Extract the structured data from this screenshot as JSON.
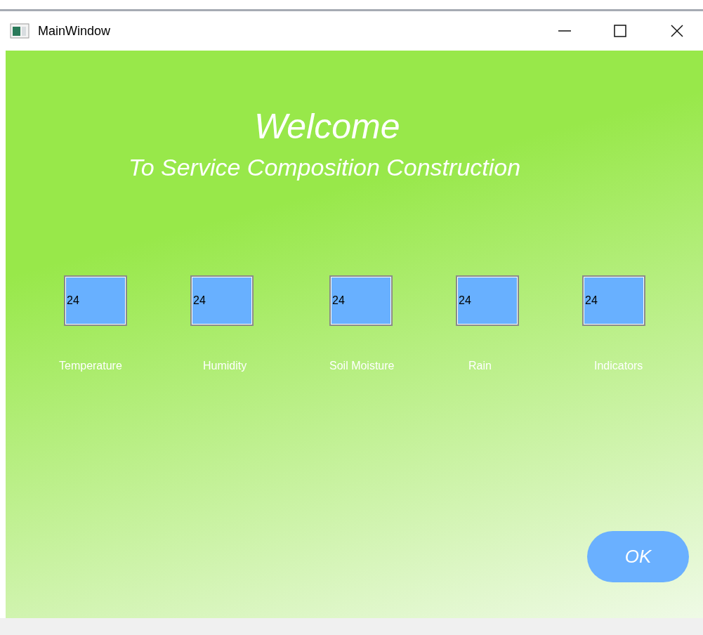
{
  "window": {
    "title": "MainWindow"
  },
  "heading": "Welcome",
  "subheading": "To Service Composition Construction",
  "sensors": [
    {
      "label": "Temperature",
      "value": "24"
    },
    {
      "label": "Humidity",
      "value": "24"
    },
    {
      "label": "Soil Moisture",
      "value": "24"
    },
    {
      "label": "Rain",
      "value": "24"
    },
    {
      "label": "Indicators",
      "value": "24"
    }
  ],
  "ok_button": "OK"
}
